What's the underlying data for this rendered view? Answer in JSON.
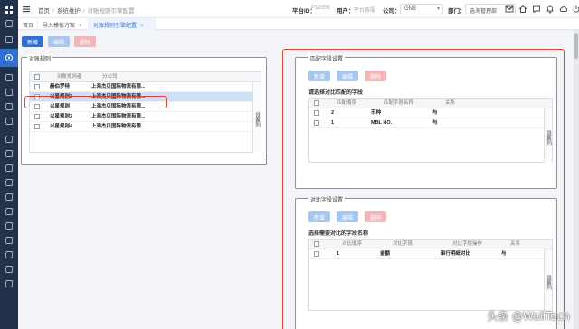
{
  "rail": {
    "icons": [
      "menu-grid-icon",
      "home-icon",
      "folder-icon",
      "compass-icon",
      "box-icon",
      "file-icon",
      "settings-icon",
      "link-icon",
      "grid-icon",
      "ship-icon",
      "building-icon",
      "doc-icon",
      "cloud-icon",
      "card-icon",
      "bag-icon",
      "bars-icon",
      "refresh-icon",
      "shield-icon",
      "info-icon"
    ]
  },
  "topbar": {
    "breadcrumb": [
      "首页",
      "系统维护",
      "对账规则引擎配置"
    ],
    "platform_label": "平台ID：",
    "platform_value": "P12056",
    "user_label": "用户：",
    "user_value": "平台客服",
    "company_label": "公司：",
    "company_value": "GNB",
    "dept_label": "部门：",
    "dept_value": "选海管理部"
  },
  "tabs": [
    {
      "label": "首页",
      "closable": false
    },
    {
      "label": "导入模板方案",
      "closable": true
    },
    {
      "label": "对账规则引擎配置",
      "closable": true,
      "active": true
    }
  ],
  "toolbar": {
    "add": "新增",
    "edit": "编辑",
    "delete": "删除"
  },
  "left_panel": {
    "legend": "对账规则",
    "columns": [
      "对账规则者",
      "分公司"
    ],
    "rows": [
      {
        "name": "赫伯罗特",
        "company": "上海杰贝国际物流有限..."
      },
      {
        "name": "以星规则2",
        "company": "上海杰贝国际物流有限...",
        "selected": true
      },
      {
        "name": "以星规则",
        "company": "上海杰贝国际物流有限..."
      },
      {
        "name": "以星规则3",
        "company": "上海杰贝国际物流有限..."
      },
      {
        "name": "以星规则4",
        "company": "上海杰贝国际物流有限..."
      }
    ],
    "side_tab": "设置列"
  },
  "match_panel": {
    "legend": "匹配字段设置",
    "buttons": {
      "add": "新增",
      "edit": "编辑",
      "delete": "删除"
    },
    "subtitle": "请选择对比匹配的字段",
    "columns": [
      "匹配顺序",
      "匹配字段名称",
      "关系"
    ],
    "rows": [
      {
        "order": "2",
        "field": "币种",
        "rel": "与"
      },
      {
        "order": "1",
        "field": "MBL NO.",
        "rel": "与"
      }
    ],
    "side_tab": "设置列"
  },
  "compare_panel": {
    "legend": "对比字段设置",
    "buttons": {
      "add": "新增",
      "edit": "编辑",
      "delete": "删除"
    },
    "subtitle": "选择需要对比的字段名称",
    "columns": [
      "对比顺序",
      "对比字段",
      "对比字段操作",
      "关系"
    ],
    "rows": [
      {
        "order": "1",
        "field": "金额",
        "op": "串行明细对比",
        "rel": "与"
      }
    ],
    "side_tab": "设置列"
  },
  "watermark": "头条 @WallTech"
}
